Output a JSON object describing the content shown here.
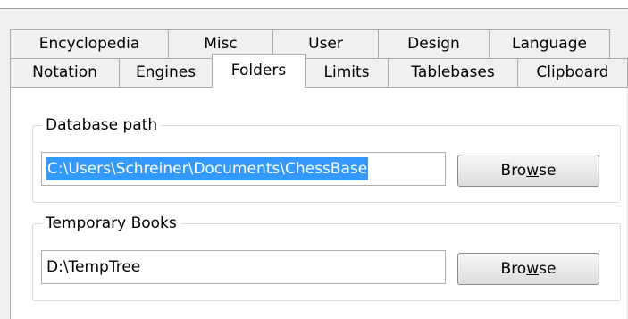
{
  "tabs_back": [
    "Encyclopedia",
    "Misc",
    "User",
    "Design",
    "Language"
  ],
  "tabs_front": [
    "Notation",
    "Engines",
    "Folders",
    "Limits",
    "Tablebases",
    "Clipboard"
  ],
  "selected_tab": "Folders",
  "database_path": {
    "legend": "Database path",
    "value": "C:\\Users\\Schreiner\\Documents\\ChessBase",
    "browse": {
      "pre": "Bro",
      "accel": "w",
      "post": "se"
    }
  },
  "temporary_books": {
    "legend": "Temporary Books",
    "value": "D:\\TempTree",
    "browse": {
      "pre": "Bro",
      "accel": "w",
      "post": "se"
    }
  }
}
